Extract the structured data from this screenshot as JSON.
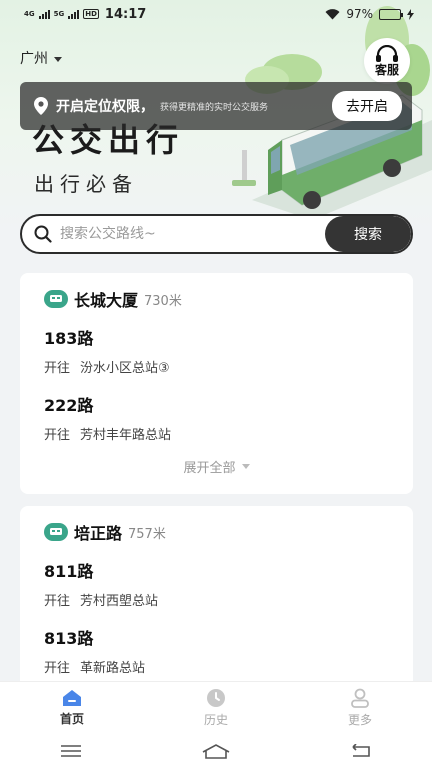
{
  "status_bar": {
    "network_1": "4G",
    "network_2": "5G",
    "hd": "HD",
    "time": "14:17",
    "battery_text": "97%",
    "battery_level": 0.97
  },
  "header": {
    "city": "广州",
    "service_label": "客服",
    "title": "公交出行",
    "subtitle": "出行必备"
  },
  "location_banner": {
    "title": "开启定位权限，",
    "description": "获得更精准的实时公交服务",
    "button": "去开启"
  },
  "search": {
    "placeholder": "搜索公交路线~",
    "button": "搜索"
  },
  "stops": [
    {
      "name": "长城大厦",
      "distance": "730米",
      "routes": [
        {
          "name": "183路",
          "direction_prefix": "开往",
          "destination": "汾水小区总站③"
        },
        {
          "name": "222路",
          "direction_prefix": "开往",
          "destination": "芳村丰年路总站"
        }
      ],
      "expand_label": "展开全部"
    },
    {
      "name": "培正路",
      "distance": "757米",
      "routes": [
        {
          "name": "811路",
          "direction_prefix": "开往",
          "destination": "芳村西塱总站"
        },
        {
          "name": "813路",
          "direction_prefix": "开往",
          "destination": "革新路总站"
        }
      ]
    }
  ],
  "bottom_nav": [
    {
      "label": "首页",
      "icon": "home-icon",
      "active": true
    },
    {
      "label": "历史",
      "icon": "clock-icon",
      "active": false
    },
    {
      "label": "更多",
      "icon": "user-icon",
      "active": false
    }
  ],
  "colors": {
    "accent": "#4a86e8",
    "stop_icon": "#3aa58a",
    "hero_green": "#e3f2e4",
    "dark_button": "#343434"
  }
}
